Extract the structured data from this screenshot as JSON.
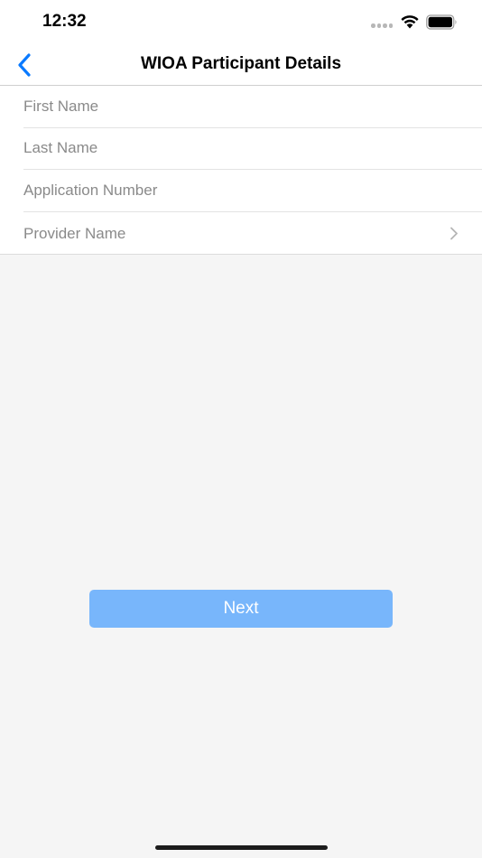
{
  "status_bar": {
    "time": "12:32"
  },
  "nav": {
    "title": "WIOA Participant Details",
    "back_icon": "chevron-left-icon"
  },
  "form": {
    "first_name": {
      "placeholder": "First Name",
      "value": ""
    },
    "last_name": {
      "placeholder": "Last Name",
      "value": ""
    },
    "application_number": {
      "placeholder": "Application Number",
      "value": ""
    },
    "provider_name": {
      "label": "Provider Name",
      "icon": "chevron-right-icon"
    }
  },
  "actions": {
    "next_label": "Next"
  },
  "colors": {
    "accent": "#0a7aff",
    "button_disabled": "#78b6fb",
    "background": "#f5f5f5"
  }
}
